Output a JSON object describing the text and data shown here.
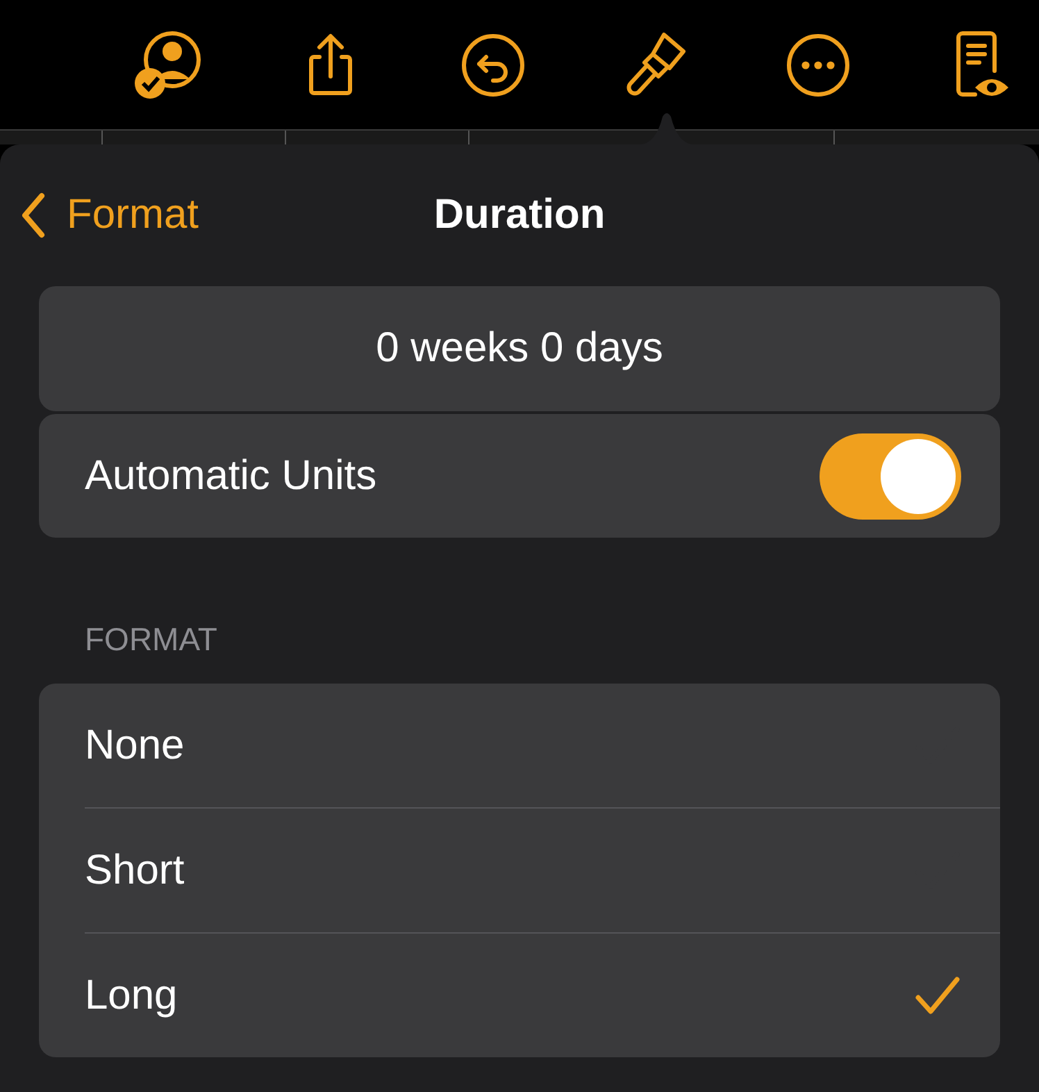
{
  "header": {
    "back_label": "Format",
    "title": "Duration"
  },
  "duration_value": "0 weeks 0 days",
  "automatic_units": {
    "label": "Automatic Units",
    "on": true
  },
  "format_section": {
    "heading": "FORMAT",
    "options": [
      {
        "label": "None",
        "selected": false
      },
      {
        "label": "Short",
        "selected": false
      },
      {
        "label": "Long",
        "selected": true
      }
    ]
  }
}
